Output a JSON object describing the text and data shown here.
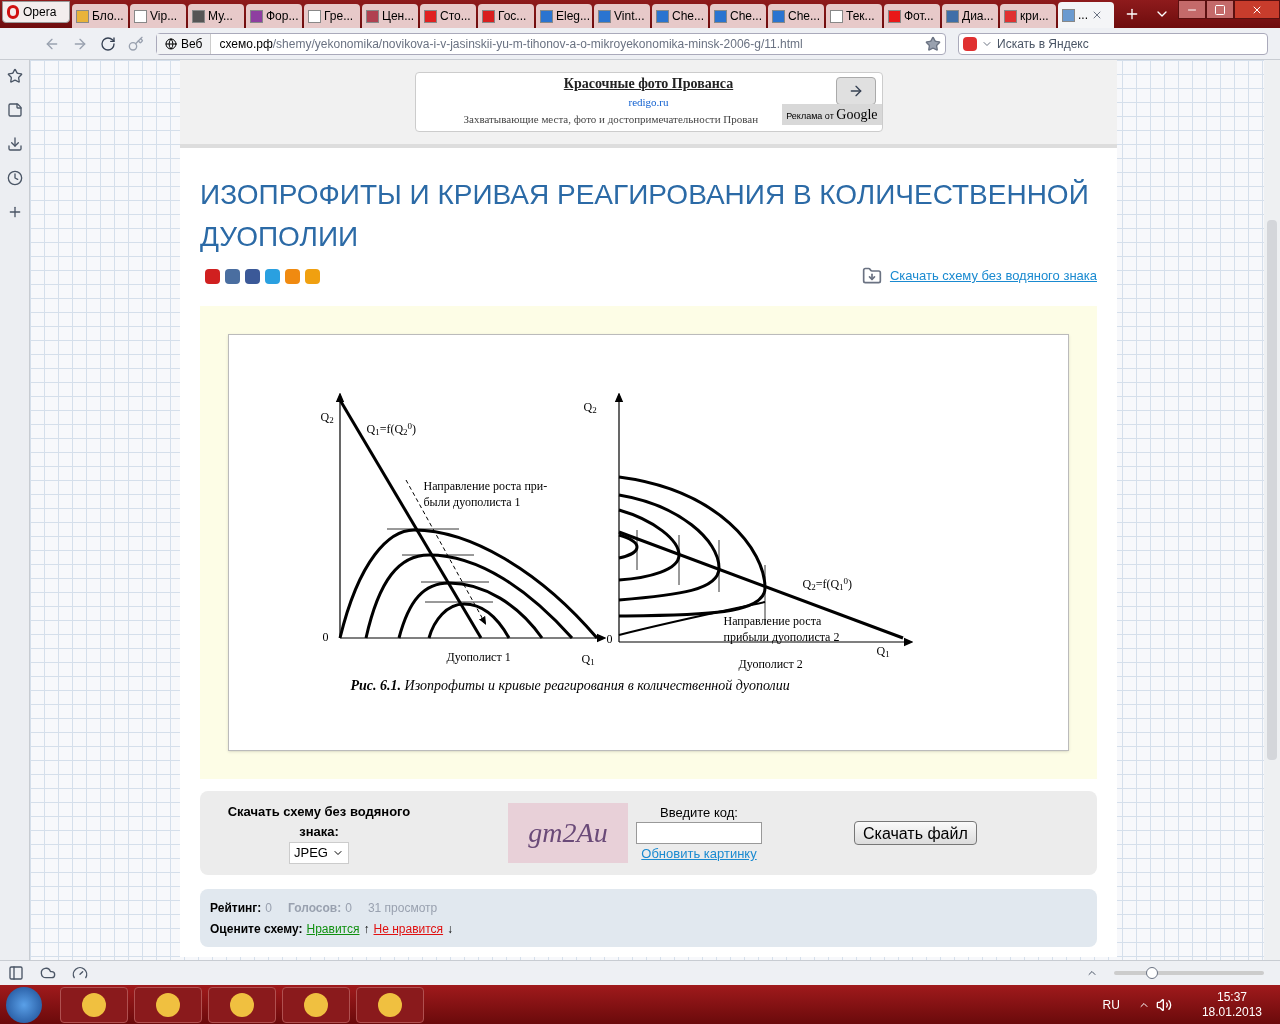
{
  "browser": {
    "menu": "Opera",
    "tabs": [
      {
        "label": "Бло...",
        "selected": false,
        "color": "#e8b33a"
      },
      {
        "label": "Vip...",
        "selected": false,
        "color": "#ffffff"
      },
      {
        "label": "Му...",
        "selected": false,
        "color": "#555555"
      },
      {
        "label": "Фор...",
        "selected": false,
        "color": "#8e3ea0"
      },
      {
        "label": "Гре...",
        "selected": false,
        "color": "#ffffff"
      },
      {
        "label": "Цен...",
        "selected": false,
        "color": "#b04050"
      },
      {
        "label": "Сто...",
        "selected": false,
        "color": "#e02020"
      },
      {
        "label": "Гос...",
        "selected": false,
        "color": "#d81e1e"
      },
      {
        "label": "Eleg...",
        "selected": false,
        "color": "#2a74d0"
      },
      {
        "label": "Vint...",
        "selected": false,
        "color": "#2a74d0"
      },
      {
        "label": "Che...",
        "selected": false,
        "color": "#2a74d0"
      },
      {
        "label": "Che...",
        "selected": false,
        "color": "#2a74d0"
      },
      {
        "label": "Che...",
        "selected": false,
        "color": "#2a74d0"
      },
      {
        "label": "Тек...",
        "selected": false,
        "color": "#ffffff"
      },
      {
        "label": "Фот...",
        "selected": false,
        "color": "#e81818"
      },
      {
        "label": "Диа...",
        "selected": false,
        "color": "#3e6ea8"
      },
      {
        "label": "кри...",
        "selected": false,
        "color": "#e03030"
      },
      {
        "label": "...",
        "selected": true,
        "color": "#6a9ad0"
      }
    ],
    "scope": "Веб",
    "address_host": "схемо.рф",
    "address_path": "/shemy/yekonomika/novikova-i-v-jasinskii-yu-m-tihonov-a-o-mikroyekonomika-minsk-2006-g/11.html",
    "search_placeholder": "Искать в Яндекс"
  },
  "ad": {
    "title": "Красочные фото Прованса",
    "domain": "redigo.ru",
    "text": "Захватывающие места, фото и достопримечательности Прован",
    "badge": "Реклама от",
    "brand": "Google"
  },
  "article": {
    "title": "ИЗОПРОФИТЫ И КРИВАЯ РЕАГИРОВАНИЯ В КОЛИЧЕСТВЕННОЙ ДУОПОЛИИ",
    "download_link": "Скачать схему без водяного знака",
    "figure": {
      "left": {
        "y_axis": "Q$_{2}$",
        "origin": "0",
        "curve": "Q$_{1}$=f(Q$_{2}$$^{0}$)",
        "direction": "Направление роста при-\nбыли дуополиста 1",
        "caption": "Дуополист 1",
        "x_axis": "Q$_{1}$"
      },
      "right": {
        "y_axis": "Q$_{2}$",
        "origin": "0",
        "curve": "Q$_{2}$=f(Q$_{1}$$^{0}$)",
        "direction": "Направление роста\nприбыли дуополиста 2",
        "caption": "Дуополист 2",
        "x_axis": "Q$_{1}$"
      },
      "caption": "**Рис. 6.1.** Изопрофиты и кривые реагирования в количественной дуополии"
    }
  },
  "download_form": {
    "label": "Скачать схему без водяного знака:",
    "format": "JPEG",
    "captcha": "gm2Au",
    "code_label": "Введите код:",
    "refresh": "Обновить картинку",
    "button": "Скачать файл"
  },
  "rating": {
    "rating_label": "Рейтинг:",
    "rating": "0",
    "votes_label": "Голосов:",
    "votes": "0",
    "views": "31 просмотр",
    "rate_label": "Оцените схему:",
    "like": "Нравится",
    "like_arrow": "↑",
    "dislike": "Не нравится",
    "dislike_arrow": "↓"
  },
  "zoom": {
    "level": 0.25
  },
  "taskbar": {
    "language": "RU",
    "time": "15:37",
    "date": "18.01.2013"
  }
}
